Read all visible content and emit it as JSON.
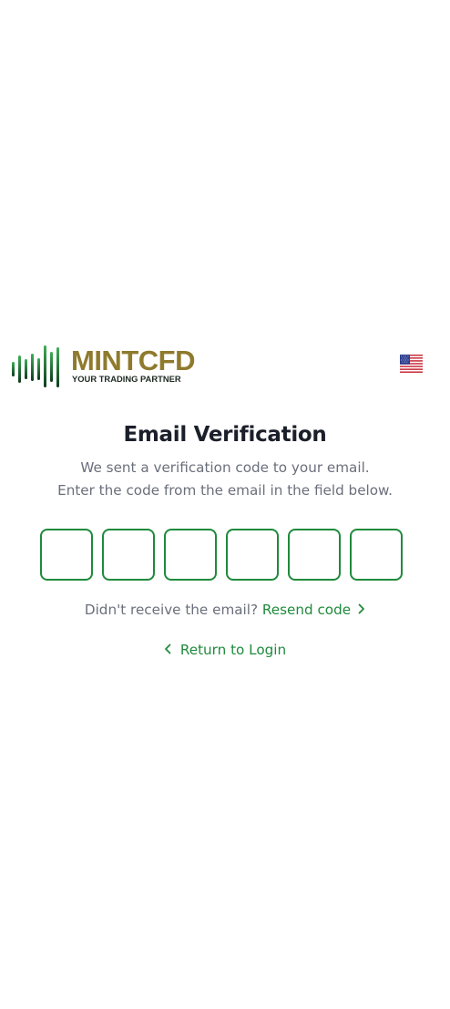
{
  "brand": {
    "name": "MINTCFD",
    "tagline": "YOUR TRADING PARTNER",
    "name_color": "#8f7a2d",
    "mark_colors": [
      "#0d3b1e",
      "#1f8a3c",
      "#3fae55"
    ]
  },
  "language": {
    "selected": "English (US)",
    "icon": "us-flag-icon"
  },
  "verification": {
    "title": "Email Verification",
    "description_line1": "We sent a verification code to your email.",
    "description_line2": "Enter the code from the email in the field below.",
    "code_length": 6,
    "code_values": [
      "",
      "",
      "",
      "",
      "",
      ""
    ]
  },
  "resend": {
    "prompt": "Didn't receive the email?",
    "link_label": "Resend code",
    "icon": "chevron-right-icon"
  },
  "return": {
    "label": "Return to Login",
    "icon": "chevron-left-icon"
  },
  "colors": {
    "accent": "#1f8a3c",
    "text_primary": "#1b1f2a",
    "text_muted": "#6b6f7b",
    "background": "#ffffff"
  }
}
